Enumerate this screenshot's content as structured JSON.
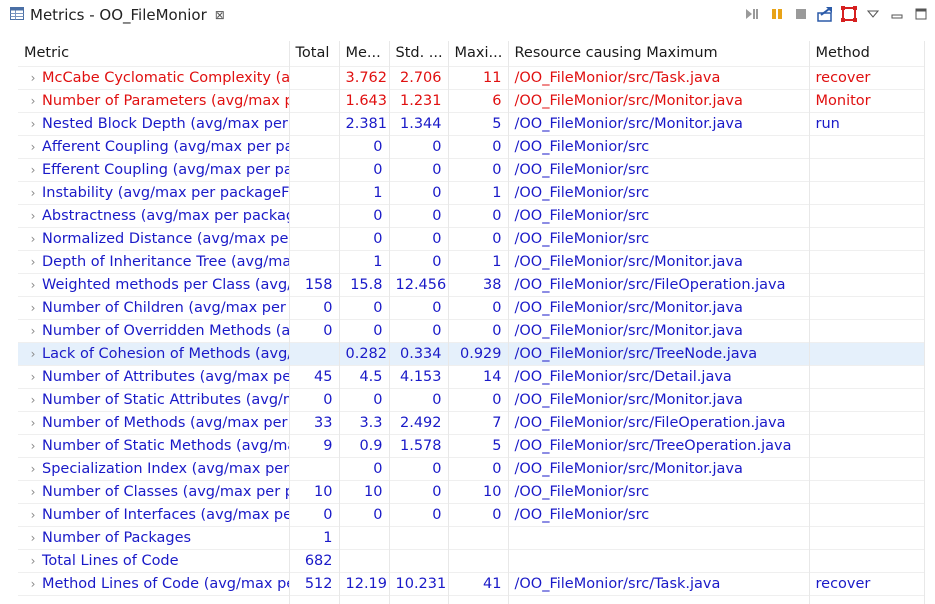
{
  "tab": {
    "title": "Metrics - OO_FileMonior",
    "icon": "table-view-icon",
    "close_icon": "close-icon"
  },
  "toolbar": {
    "icons": [
      "step-icon",
      "pause-icon",
      "stop-icon",
      "export-icon",
      "layout-icon",
      "view-menu-icon",
      "minimize-icon",
      "maximize-icon"
    ]
  },
  "columns": [
    "Metric",
    "Total",
    "Me...",
    "Std. ...",
    "Maxi...",
    "Resource causing Maximum",
    "Method"
  ],
  "rows": [
    {
      "metric": "McCabe Cyclomatic Complexity (avg/max per method)",
      "total": "",
      "mean": "3.762",
      "std": "2.706",
      "max": "11",
      "resource": "/OO_FileMonior/src/Task.java",
      "method": "recover",
      "state": "warn"
    },
    {
      "metric": "Number of Parameters (avg/max per method)",
      "total": "",
      "mean": "1.643",
      "std": "1.231",
      "max": "6",
      "resource": "/OO_FileMonior/src/Monitor.java",
      "method": "Monitor",
      "state": "warn"
    },
    {
      "metric": "Nested Block Depth (avg/max per method)",
      "total": "",
      "mean": "2.381",
      "std": "1.344",
      "max": "5",
      "resource": "/OO_FileMonior/src/Monitor.java",
      "method": "run",
      "state": "normal"
    },
    {
      "metric": "Afferent Coupling (avg/max per packageFragment)",
      "total": "",
      "mean": "0",
      "std": "0",
      "max": "0",
      "resource": "/OO_FileMonior/src",
      "method": "",
      "state": "normal"
    },
    {
      "metric": "Efferent Coupling (avg/max per packageFragment)",
      "total": "",
      "mean": "0",
      "std": "0",
      "max": "0",
      "resource": "/OO_FileMonior/src",
      "method": "",
      "state": "normal"
    },
    {
      "metric": "Instability (avg/max per packageFragment)",
      "total": "",
      "mean": "1",
      "std": "0",
      "max": "1",
      "resource": "/OO_FileMonior/src",
      "method": "",
      "state": "normal"
    },
    {
      "metric": "Abstractness (avg/max per packageFragment)",
      "total": "",
      "mean": "0",
      "std": "0",
      "max": "0",
      "resource": "/OO_FileMonior/src",
      "method": "",
      "state": "normal"
    },
    {
      "metric": "Normalized Distance (avg/max per packageFragment)",
      "total": "",
      "mean": "0",
      "std": "0",
      "max": "0",
      "resource": "/OO_FileMonior/src",
      "method": "",
      "state": "normal"
    },
    {
      "metric": "Depth of Inheritance Tree (avg/max per type)",
      "total": "",
      "mean": "1",
      "std": "0",
      "max": "1",
      "resource": "/OO_FileMonior/src/Monitor.java",
      "method": "",
      "state": "normal"
    },
    {
      "metric": "Weighted methods per Class (avg/max per type)",
      "total": "158",
      "mean": "15.8",
      "std": "12.456",
      "max": "38",
      "resource": "/OO_FileMonior/src/FileOperation.java",
      "method": "",
      "state": "normal"
    },
    {
      "metric": "Number of Children (avg/max per type)",
      "total": "0",
      "mean": "0",
      "std": "0",
      "max": "0",
      "resource": "/OO_FileMonior/src/Monitor.java",
      "method": "",
      "state": "normal"
    },
    {
      "metric": "Number of Overridden Methods (avg/max per type)",
      "total": "0",
      "mean": "0",
      "std": "0",
      "max": "0",
      "resource": "/OO_FileMonior/src/Monitor.java",
      "method": "",
      "state": "normal"
    },
    {
      "metric": "Lack of Cohesion of Methods (avg/max per type)",
      "total": "",
      "mean": "0.282",
      "std": "0.334",
      "max": "0.929",
      "resource": "/OO_FileMonior/src/TreeNode.java",
      "method": "",
      "state": "selected"
    },
    {
      "metric": "Number of Attributes (avg/max per type)",
      "total": "45",
      "mean": "4.5",
      "std": "4.153",
      "max": "14",
      "resource": "/OO_FileMonior/src/Detail.java",
      "method": "",
      "state": "normal"
    },
    {
      "metric": "Number of Static Attributes (avg/max per type)",
      "total": "0",
      "mean": "0",
      "std": "0",
      "max": "0",
      "resource": "/OO_FileMonior/src/Monitor.java",
      "method": "",
      "state": "normal"
    },
    {
      "metric": "Number of Methods (avg/max per type)",
      "total": "33",
      "mean": "3.3",
      "std": "2.492",
      "max": "7",
      "resource": "/OO_FileMonior/src/FileOperation.java",
      "method": "",
      "state": "normal"
    },
    {
      "metric": "Number of Static Methods (avg/max per type)",
      "total": "9",
      "mean": "0.9",
      "std": "1.578",
      "max": "5",
      "resource": "/OO_FileMonior/src/TreeOperation.java",
      "method": "",
      "state": "normal"
    },
    {
      "metric": "Specialization Index (avg/max per type)",
      "total": "",
      "mean": "0",
      "std": "0",
      "max": "0",
      "resource": "/OO_FileMonior/src/Monitor.java",
      "method": "",
      "state": "normal"
    },
    {
      "metric": "Number of Classes (avg/max per packageFragment)",
      "total": "10",
      "mean": "10",
      "std": "0",
      "max": "10",
      "resource": "/OO_FileMonior/src",
      "method": "",
      "state": "normal"
    },
    {
      "metric": "Number of Interfaces (avg/max per packageFragment)",
      "total": "0",
      "mean": "0",
      "std": "0",
      "max": "0",
      "resource": "/OO_FileMonior/src",
      "method": "",
      "state": "normal"
    },
    {
      "metric": "Number of Packages",
      "total": "1",
      "mean": "",
      "std": "",
      "max": "",
      "resource": "",
      "method": "",
      "state": "normal"
    },
    {
      "metric": "Total Lines of Code",
      "total": "682",
      "mean": "",
      "std": "",
      "max": "",
      "resource": "",
      "method": "",
      "state": "normal"
    },
    {
      "metric": "Method Lines of Code (avg/max per method)",
      "total": "512",
      "mean": "12.19",
      "std": "10.231",
      "max": "41",
      "resource": "/OO_FileMonior/src/Task.java",
      "method": "recover",
      "state": "normal"
    }
  ]
}
